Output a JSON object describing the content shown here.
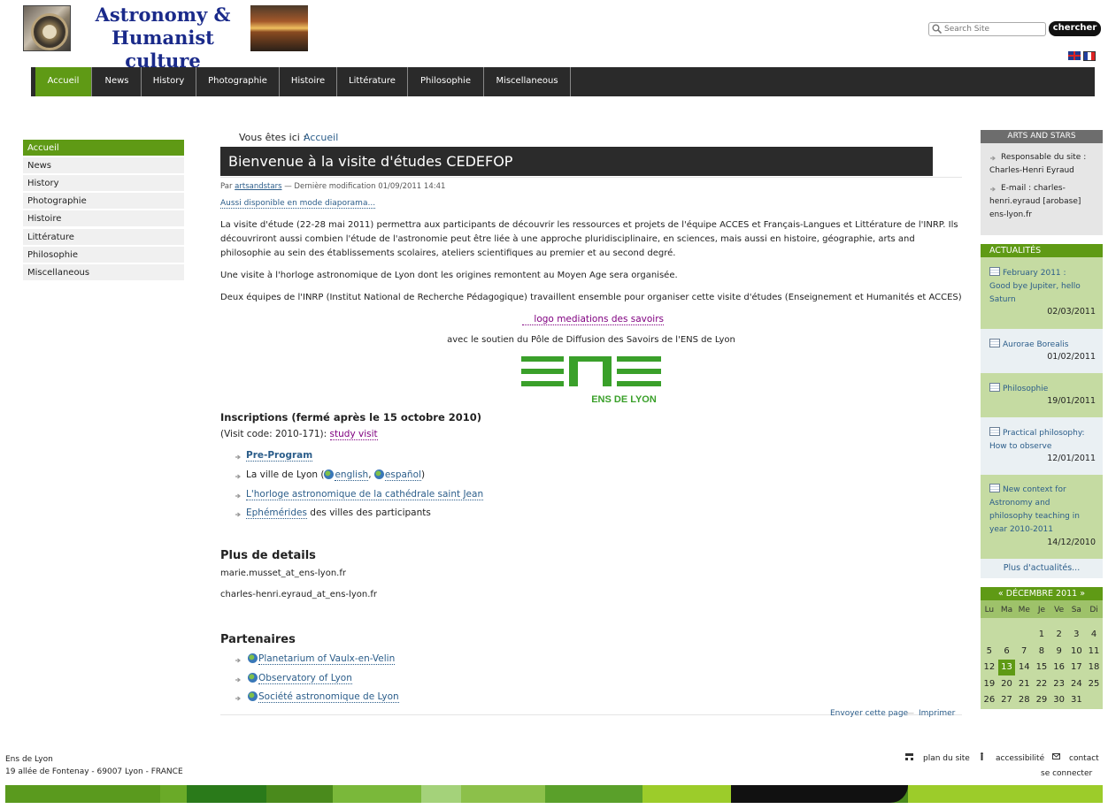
{
  "header": {
    "title_line1": "Astronomy &",
    "title_line2": "Humanist culture",
    "search_placeholder": "Search Site",
    "search_button": "chercher"
  },
  "topnav": [
    "Accueil",
    "News",
    "History",
    "Photographie",
    "Histoire",
    "Littérature",
    "Philosophie",
    "Miscellaneous"
  ],
  "sidebar": [
    "Accueil",
    "News",
    "History",
    "Photographie",
    "Histoire",
    "Littérature",
    "Philosophie",
    "Miscellaneous"
  ],
  "breadcrumb": {
    "label": "Vous êtes ici :",
    "link": "Accueil"
  },
  "article": {
    "title": "Bienvenue à la visite d'études CEDEFOP",
    "byline_prefix": "Par",
    "byline_author": "artsandstars",
    "byline_suffix": "— Dernière modification 01/09/2011 14:41",
    "slideshow": "Aussi disponible en mode diaporama...",
    "para1": "La visite d'étude (22-28 mai 2011) permettra aux participants de découvrir les ressources et projets de l'équipe ACCES et Français-Langues et Littérature de l'INRP. Ils découvriront aussi combien l'étude de l'astronomie peut être liée à une approche pluridisciplinaire, en sciences, mais aussi en histoire, géographie, arts and philosophie au sein des établissements scolaires, ateliers scientifiques au premier et au second degré.",
    "para2": "Une visite à l'horloge astronomique de Lyon dont les origines remontent au Moyen Age sera organisée.",
    "para3": "Deux équipes de l'INRP (Institut National de Recherche Pédagogique) travaillent ensemble pour organiser cette visite d'études (Enseignement et Humanités et ACCES)",
    "logo_link": "logo mediations des savoirs",
    "support": "avec le soutien du Pôle de Diffusion des Savoirs de l'ENS de Lyon",
    "ens_logo_text": "ENS DE LYON",
    "inscriptions_heading": "Inscriptions (fermé après le 15 octobre 2010)",
    "visit_code_prefix": "(Visit code: 2010-171):",
    "visit_code_link": "study visit",
    "list": {
      "preprogram": "Pre-Program",
      "lyon_prefix": "La ville de Lyon (",
      "lyon_english": "english",
      "lyon_sep": ",",
      "lyon_espanol": "español",
      "lyon_suffix": ")",
      "horloge": "L'horloge astronomique de la cathédrale saint Jean",
      "ephemerides_link": "Ephémérides",
      "ephemerides_suffix": "des villes des participants"
    },
    "details_heading": "Plus de details",
    "email1": "marie.musset_at_ens-lyon.fr",
    "email2": "charles-henri.eyraud_at_ens-lyon.fr",
    "partners_heading": "Partenaires",
    "partners": [
      "Planetarium of Vaulx-en-Velin",
      "Observatory of Lyon",
      "Société astronomique de Lyon"
    ],
    "send_page": "Envoyer cette page",
    "separator": "—",
    "print": "Imprimer"
  },
  "right": {
    "arts_header": "ARTS AND STARS",
    "arts_lines": [
      "Responsable du site :",
      "Charles-Henri Eyraud",
      "E-mail : charles-",
      "henri.eyraud [arobase]",
      "ens-lyon.fr"
    ],
    "news_header": "ACTUALITÉS",
    "news": [
      {
        "title_lines": [
          "February 2011 :",
          "Good bye Jupiter, hello",
          "Saturn"
        ],
        "date": "02/03/2011"
      },
      {
        "title_lines": [
          "Aurorae Borealis"
        ],
        "date": "01/02/2011"
      },
      {
        "title_lines": [
          "Philosophie"
        ],
        "date": "19/01/2011"
      },
      {
        "title_lines": [
          "Practical philosophy:",
          "How to observe"
        ],
        "date": "12/01/2011"
      },
      {
        "title_lines": [
          "New context for",
          "Astronomy and",
          "philosophy teaching in",
          "year 2010-2011"
        ],
        "date": "14/12/2010"
      }
    ],
    "more_news": "Plus d'actualités..."
  },
  "calendar": {
    "header": "« DÉCEMBRE 2011 »",
    "day_names": [
      "Lu",
      "Ma",
      "Me",
      "Je",
      "Ve",
      "Sa",
      "Di"
    ],
    "weeks": [
      [
        "",
        "",
        "",
        "1",
        "2",
        "3",
        "4"
      ],
      [
        "5",
        "6",
        "7",
        "8",
        "9",
        "10",
        "11"
      ],
      [
        "12",
        "13",
        "14",
        "15",
        "16",
        "17",
        "18"
      ],
      [
        "19",
        "20",
        "21",
        "22",
        "23",
        "24",
        "25"
      ],
      [
        "26",
        "27",
        "28",
        "29",
        "30",
        "31",
        ""
      ]
    ],
    "today": "13"
  },
  "footer": {
    "org": "Ens de Lyon",
    "address": "19 allée de Fontenay - 69007 Lyon - FRANCE",
    "sitemap": "plan du site",
    "accessibility": "accessibilité",
    "contact": "contact",
    "login": "se connecter"
  },
  "colors": {
    "accent_green": "#5f9a15",
    "nav_dark": "#2a2a2a",
    "link_blue": "#2b5d8a",
    "visited_purple": "#800080"
  }
}
